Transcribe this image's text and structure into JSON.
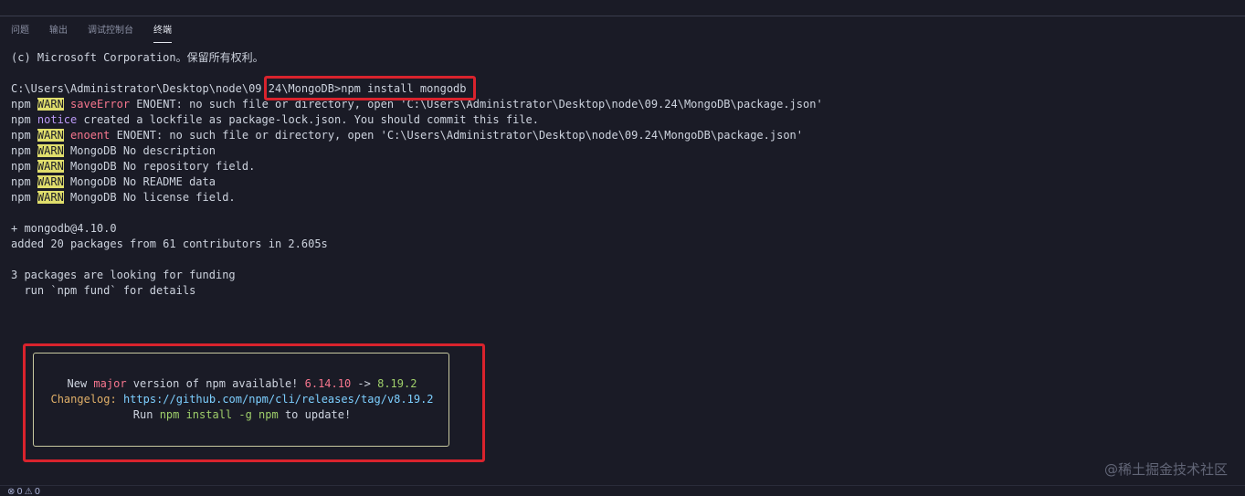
{
  "tabs": [
    {
      "label": "问题",
      "active": false
    },
    {
      "label": "输出",
      "active": false
    },
    {
      "label": "调试控制台",
      "active": false
    },
    {
      "label": "终端",
      "active": true
    }
  ],
  "terminal": {
    "copyright": "(c) Microsoft Corporation。保留所有权利。",
    "prompt_line": "C:\\Users\\Administrator\\Desktop\\node\\09.24\\MongoDB>npm install mongodb",
    "npm_prefix": "npm ",
    "warn_badge": "WARN",
    "notice_label": "notice",
    "line_saveerror_tag": "saveError",
    "line_saveerror_text": " ENOENT: no such file or directory, open 'C:\\Users\\Administrator\\Desktop\\node\\09.24\\MongoDB\\package.json'",
    "line_notice_text": " created a lockfile as package-lock.json. You should commit this file.",
    "line_enoent_tag": "enoent",
    "line_enoent_text": " ENOENT: no such file or directory, open 'C:\\Users\\Administrator\\Desktop\\node\\09.24\\MongoDB\\package.json'",
    "warn_description": " MongoDB No description",
    "warn_repository": " MongoDB No repository field.",
    "warn_readme": " MongoDB No README data",
    "warn_license": " MongoDB No license field.",
    "installed": "+ mongodb@4.10.0",
    "added": "added 20 packages from 61 contributors in 2.605s",
    "funding_1": "3 packages are looking for funding",
    "funding_2": "  run `npm fund` for details"
  },
  "update_notice": {
    "line1_prefix": "New ",
    "line1_major": "major",
    "line1_mid": " version of npm available! ",
    "line1_old": "6.14.10",
    "line1_arrow": " -> ",
    "line1_new": "8.19.2",
    "line2_label": "Changelog:",
    "line2_url": " https://github.com/npm/cli/releases/tag/v8.19.2",
    "line3_prefix": "Run ",
    "line3_cmd": "npm install -g npm",
    "line3_suffix": " to update!"
  },
  "status_bar": {
    "errors_icon": "⊗",
    "errors_count": "0",
    "warnings_icon": "⚠",
    "warnings_count": "0"
  },
  "watermark": "@稀土掘金技术社区",
  "colors": {
    "background": "#1a1b26",
    "warn_badge": "#e0de6c",
    "highlight_box": "#d9232d"
  }
}
